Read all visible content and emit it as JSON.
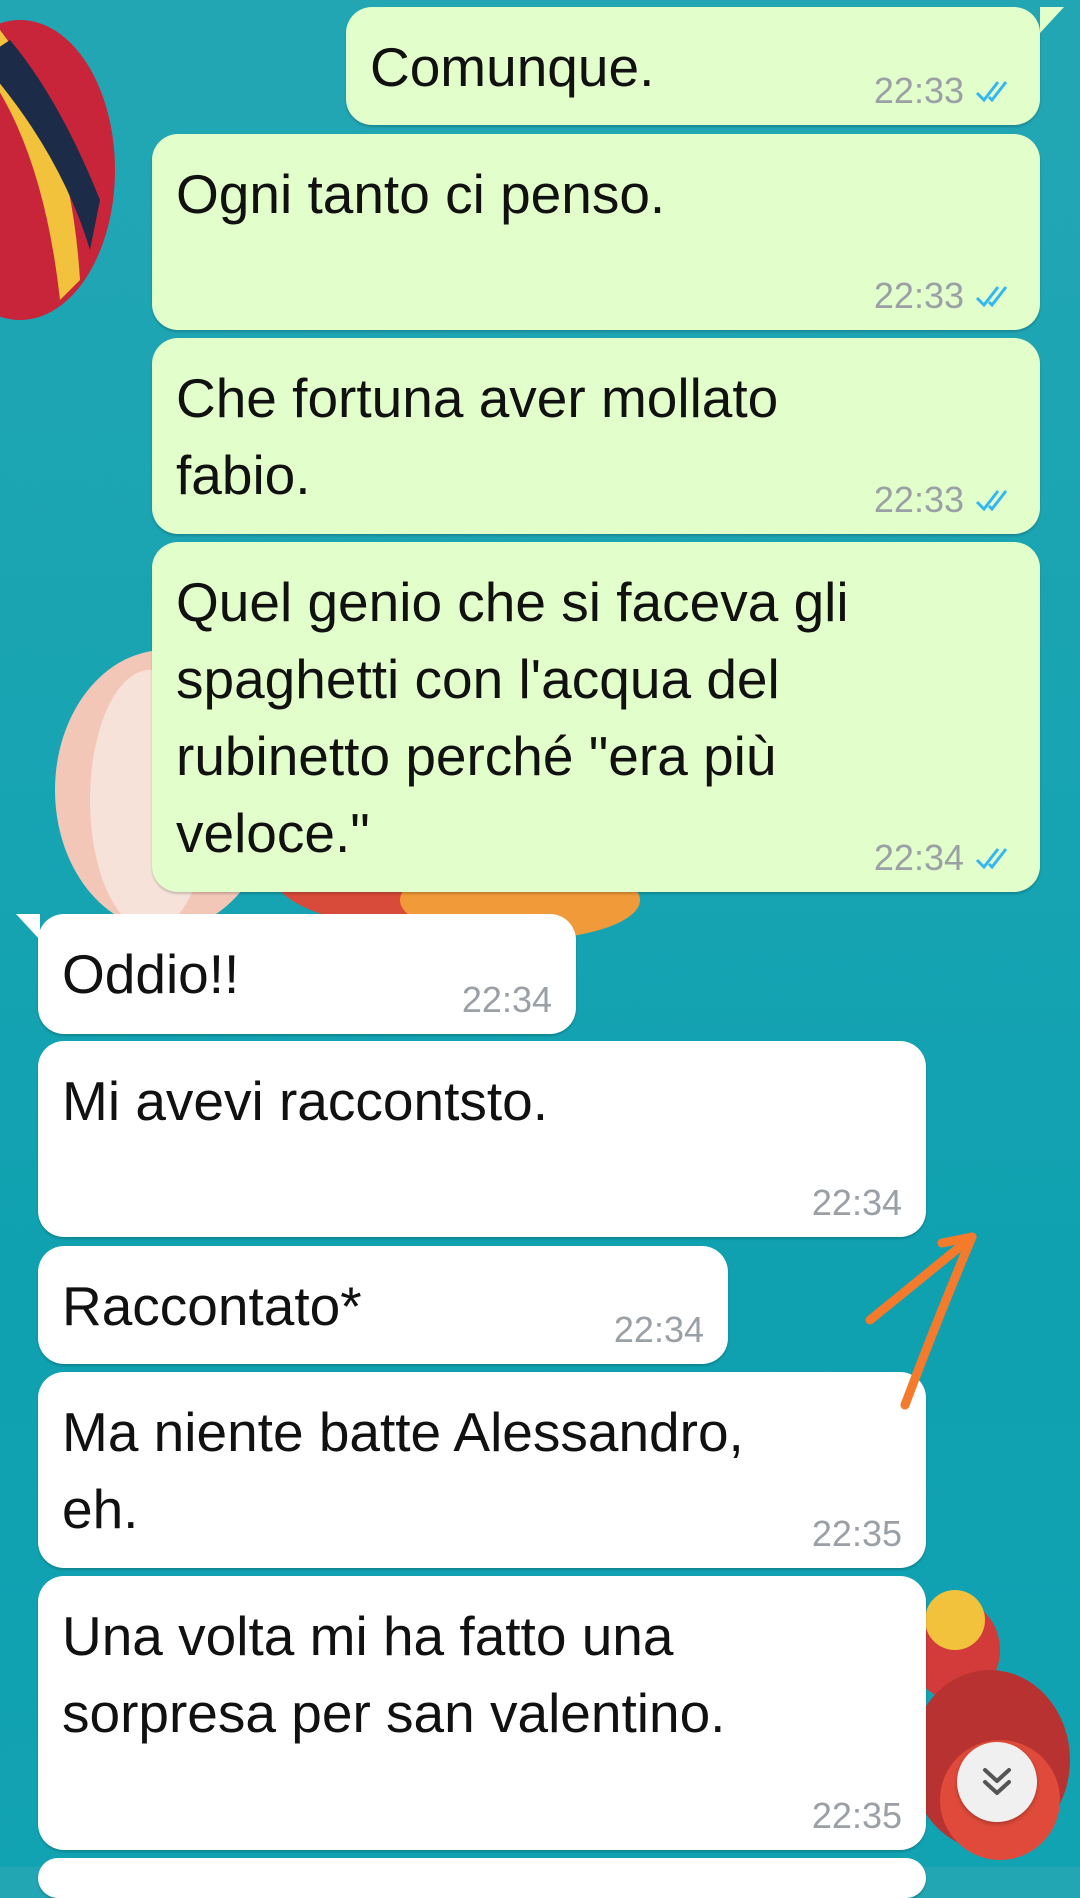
{
  "colors": {
    "outgoing_bubble": "#e2fecb",
    "incoming_bubble": "#ffffff",
    "read_ticks": "#34b7f1",
    "timestamp": "#9aa0a6",
    "annotation_arrow": "#f47a2c",
    "background": "#1ba5b3"
  },
  "messages": [
    {
      "direction": "outgoing",
      "text": "Comunque.",
      "time": "22:33",
      "status_icon": "double-check-read-icon"
    },
    {
      "direction": "outgoing",
      "text": "Ogni tanto ci penso.",
      "time": "22:33",
      "status_icon": "double-check-read-icon"
    },
    {
      "direction": "outgoing",
      "text": "Che fortuna aver mollato\nfabio.",
      "time": "22:33",
      "status_icon": "double-check-read-icon"
    },
    {
      "direction": "outgoing",
      "text": "Quel genio che si faceva gli\nspaghetti con l'acqua del\nrubinetto perché \"era più\nveloce.\"",
      "time": "22:34",
      "status_icon": "double-check-read-icon"
    },
    {
      "direction": "incoming",
      "text": "Oddio!!",
      "time": "22:34"
    },
    {
      "direction": "incoming",
      "text": "Mi avevi raccontsto.",
      "time": "22:34"
    },
    {
      "direction": "incoming",
      "text": "Raccontato*",
      "time": "22:34"
    },
    {
      "direction": "incoming",
      "text": "Ma niente batte Alessandro,\neh.",
      "time": "22:35"
    },
    {
      "direction": "incoming",
      "text": "Una volta mi ha fatto una\nsorpresa per san valentino.",
      "time": "22:35"
    }
  ],
  "scroll_button": {
    "icon": "double-chevron-down-icon"
  },
  "annotation": {
    "icon": "orange-arrow-annotation-icon"
  }
}
